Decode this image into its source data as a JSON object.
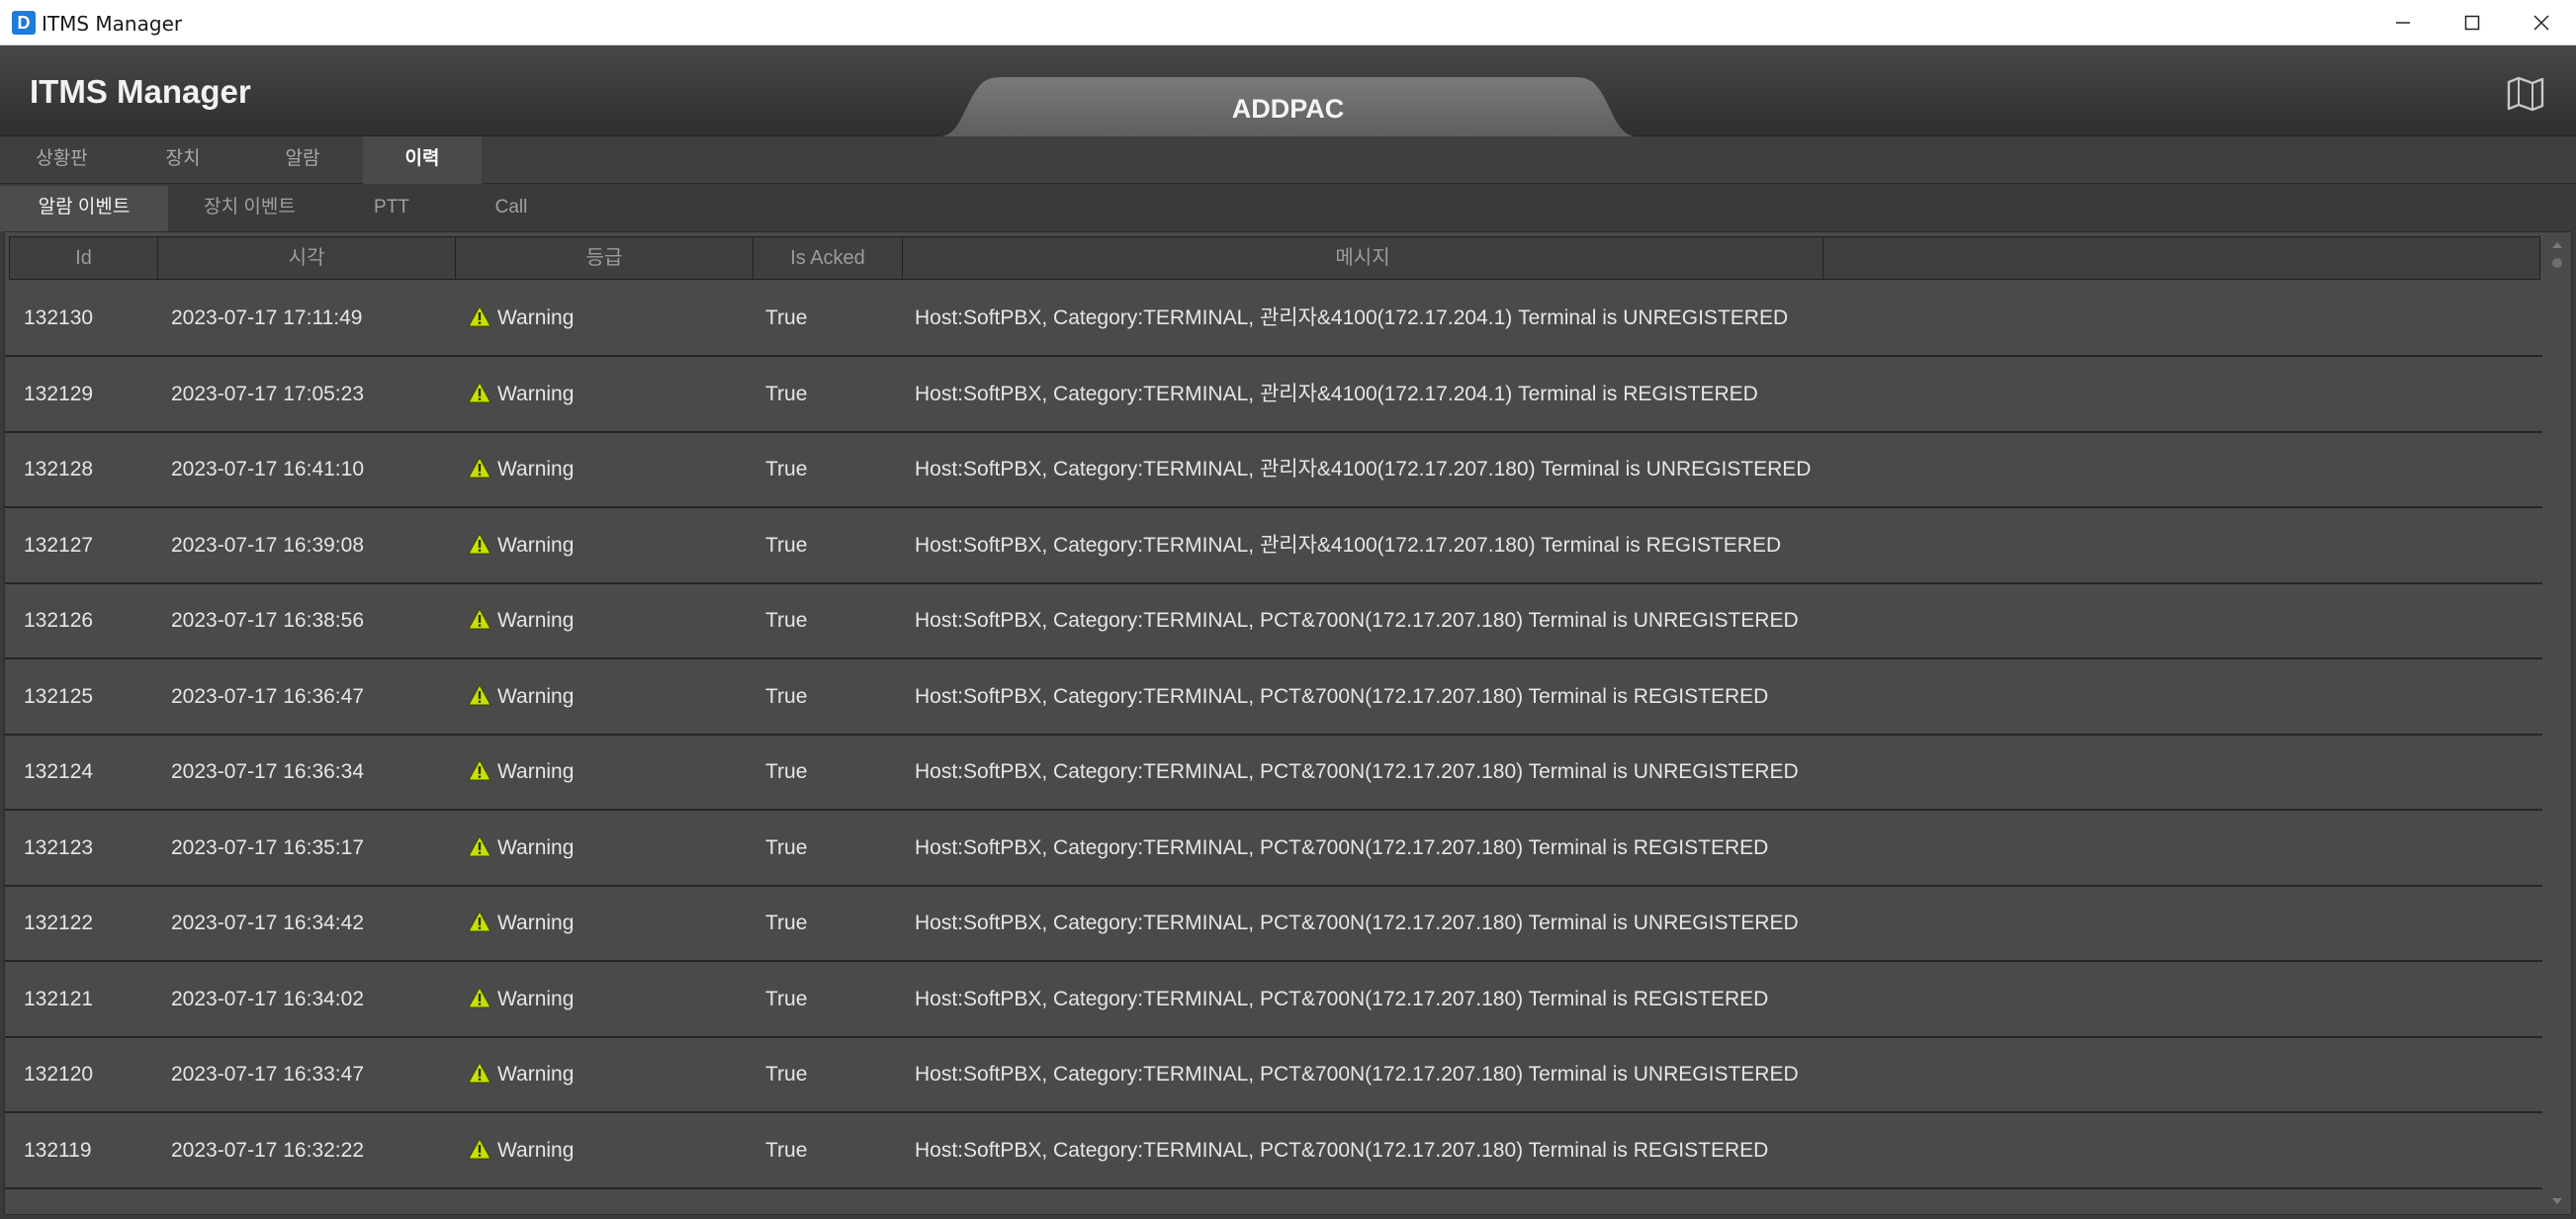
{
  "window": {
    "title": "ITMS Manager",
    "app_icon_letter": "D"
  },
  "header": {
    "app_title": "ITMS Manager",
    "site_tab": "ADDPAC",
    "map_icon": "map-icon"
  },
  "main_tabs": [
    {
      "label": "상황판",
      "active": false
    },
    {
      "label": "장치",
      "active": false
    },
    {
      "label": "알람",
      "active": false
    },
    {
      "label": "이력",
      "active": true
    }
  ],
  "sub_tabs": [
    {
      "label": "알람 이벤트",
      "active": true
    },
    {
      "label": "장치 이벤트",
      "active": false
    },
    {
      "label": "PTT",
      "active": false
    },
    {
      "label": "Call",
      "active": false
    }
  ],
  "table": {
    "columns": [
      "Id",
      "시각",
      "등급",
      "Is Acked",
      "메시지"
    ],
    "rows": [
      {
        "id": "132130",
        "time": "2023-07-17 17:11:49",
        "level": "Warning",
        "acked": "True",
        "message": "Host:SoftPBX, Category:TERMINAL, 관리자&4100(172.17.204.1) Terminal is UNREGISTERED"
      },
      {
        "id": "132129",
        "time": "2023-07-17 17:05:23",
        "level": "Warning",
        "acked": "True",
        "message": "Host:SoftPBX, Category:TERMINAL, 관리자&4100(172.17.204.1) Terminal is REGISTERED"
      },
      {
        "id": "132128",
        "time": "2023-07-17 16:41:10",
        "level": "Warning",
        "acked": "True",
        "message": "Host:SoftPBX, Category:TERMINAL, 관리자&4100(172.17.207.180) Terminal is UNREGISTERED"
      },
      {
        "id": "132127",
        "time": "2023-07-17 16:39:08",
        "level": "Warning",
        "acked": "True",
        "message": "Host:SoftPBX, Category:TERMINAL, 관리자&4100(172.17.207.180) Terminal is REGISTERED"
      },
      {
        "id": "132126",
        "time": "2023-07-17 16:38:56",
        "level": "Warning",
        "acked": "True",
        "message": "Host:SoftPBX, Category:TERMINAL, PCT&700N(172.17.207.180) Terminal is UNREGISTERED"
      },
      {
        "id": "132125",
        "time": "2023-07-17 16:36:47",
        "level": "Warning",
        "acked": "True",
        "message": "Host:SoftPBX, Category:TERMINAL, PCT&700N(172.17.207.180) Terminal is REGISTERED"
      },
      {
        "id": "132124",
        "time": "2023-07-17 16:36:34",
        "level": "Warning",
        "acked": "True",
        "message": "Host:SoftPBX, Category:TERMINAL, PCT&700N(172.17.207.180) Terminal is UNREGISTERED"
      },
      {
        "id": "132123",
        "time": "2023-07-17 16:35:17",
        "level": "Warning",
        "acked": "True",
        "message": "Host:SoftPBX, Category:TERMINAL, PCT&700N(172.17.207.180) Terminal is REGISTERED"
      },
      {
        "id": "132122",
        "time": "2023-07-17 16:34:42",
        "level": "Warning",
        "acked": "True",
        "message": "Host:SoftPBX, Category:TERMINAL, PCT&700N(172.17.207.180) Terminal is UNREGISTERED"
      },
      {
        "id": "132121",
        "time": "2023-07-17 16:34:02",
        "level": "Warning",
        "acked": "True",
        "message": "Host:SoftPBX, Category:TERMINAL, PCT&700N(172.17.207.180) Terminal is REGISTERED"
      },
      {
        "id": "132120",
        "time": "2023-07-17 16:33:47",
        "level": "Warning",
        "acked": "True",
        "message": "Host:SoftPBX, Category:TERMINAL, PCT&700N(172.17.207.180) Terminal is UNREGISTERED"
      },
      {
        "id": "132119",
        "time": "2023-07-17 16:32:22",
        "level": "Warning",
        "acked": "True",
        "message": "Host:SoftPBX, Category:TERMINAL, PCT&700N(172.17.207.180) Terminal is REGISTERED"
      }
    ]
  },
  "colors": {
    "warning_icon": "#c8e000",
    "header_bg": "#3a3a3a",
    "grid_bg": "#4a4a4a"
  }
}
